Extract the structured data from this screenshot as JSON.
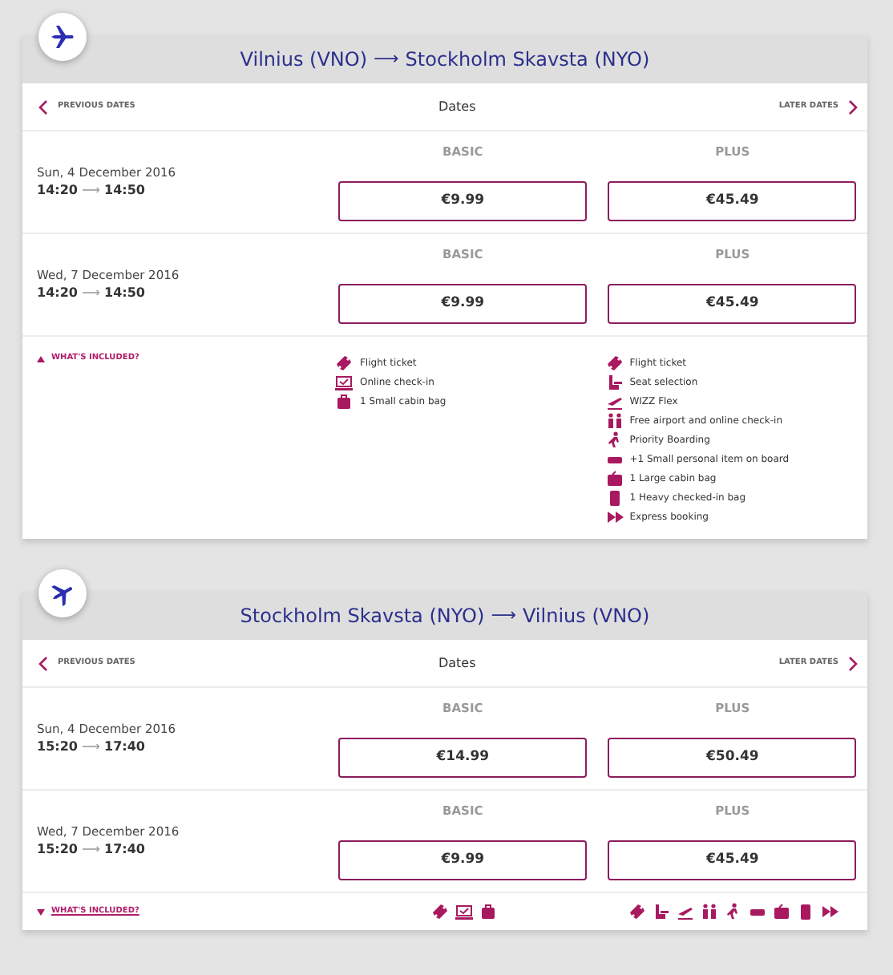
{
  "flights": [
    {
      "from": "Vilnius (VNO)",
      "arrow": "⟶",
      "to": "Stockholm Skavsta (NYO)",
      "previous": "PREVIOUS DATES",
      "dates": "Dates",
      "later": "LATER DATES",
      "days": [
        {
          "date": "Sun, 4 December 2016",
          "depart": "14:20",
          "arrow": "⟶",
          "arrive": "14:50",
          "fares": [
            {
              "label": "BASIC",
              "price": "€9.99"
            },
            {
              "label": "PLUS",
              "price": "€45.49"
            }
          ]
        },
        {
          "date": "Wed, 7 December 2016",
          "depart": "14:20",
          "arrow": "⟶",
          "arrive": "14:50",
          "fares": [
            {
              "label": "BASIC",
              "price": "€9.99"
            },
            {
              "label": "PLUS",
              "price": "€45.49"
            }
          ]
        }
      ],
      "included": {
        "label": "WHAT'S INCLUDED?",
        "expanded": true,
        "columns": [
          [
            {
              "kind": "ticket",
              "text": "Flight ticket"
            },
            {
              "kind": "checkin",
              "text": "Online check-in"
            },
            {
              "kind": "bag",
              "text": "1 Small cabin bag"
            }
          ],
          [
            {
              "kind": "ticket",
              "text": "Flight ticket"
            },
            {
              "kind": "seat",
              "text": "Seat selection"
            },
            {
              "kind": "flex",
              "text": "WIZZ Flex"
            },
            {
              "kind": "people",
              "text": "Free airport and online check-in"
            },
            {
              "kind": "walk",
              "text": "Priority Boarding"
            },
            {
              "kind": "personal",
              "text": "+1 Small personal item on board"
            },
            {
              "kind": "largebag",
              "text": "1 Large cabin bag"
            },
            {
              "kind": "checkedbag",
              "text": "1 Heavy checked-in bag"
            },
            {
              "kind": "fast",
              "text": "Express booking"
            }
          ]
        ]
      }
    },
    {
      "from": "Stockholm Skavsta (NYO)",
      "arrow": "⟶",
      "to": "Vilnius (VNO)",
      "previous": "PREVIOUS DATES",
      "dates": "Dates",
      "later": "LATER DATES",
      "days": [
        {
          "date": "Sun, 4 December 2016",
          "depart": "15:20",
          "arrow": "⟶",
          "arrive": "17:40",
          "fares": [
            {
              "label": "BASIC",
              "price": "€14.99"
            },
            {
              "label": "PLUS",
              "price": "€50.49"
            }
          ]
        },
        {
          "date": "Wed, 7 December 2016",
          "depart": "15:20",
          "arrow": "⟶",
          "arrive": "17:40",
          "fares": [
            {
              "label": "BASIC",
              "price": "€9.99"
            },
            {
              "label": "PLUS",
              "price": "€45.49"
            }
          ]
        }
      ],
      "included": {
        "label": "WHAT'S INCLUDED?",
        "expanded": false,
        "columns": [
          [
            {
              "kind": "ticket"
            },
            {
              "kind": "checkin"
            },
            {
              "kind": "bag"
            }
          ],
          [
            {
              "kind": "ticket"
            },
            {
              "kind": "seat"
            },
            {
              "kind": "flex"
            },
            {
              "kind": "people"
            },
            {
              "kind": "walk"
            },
            {
              "kind": "personal"
            },
            {
              "kind": "largebag"
            },
            {
              "kind": "checkedbag"
            },
            {
              "kind": "fast"
            }
          ]
        ]
      }
    }
  ]
}
